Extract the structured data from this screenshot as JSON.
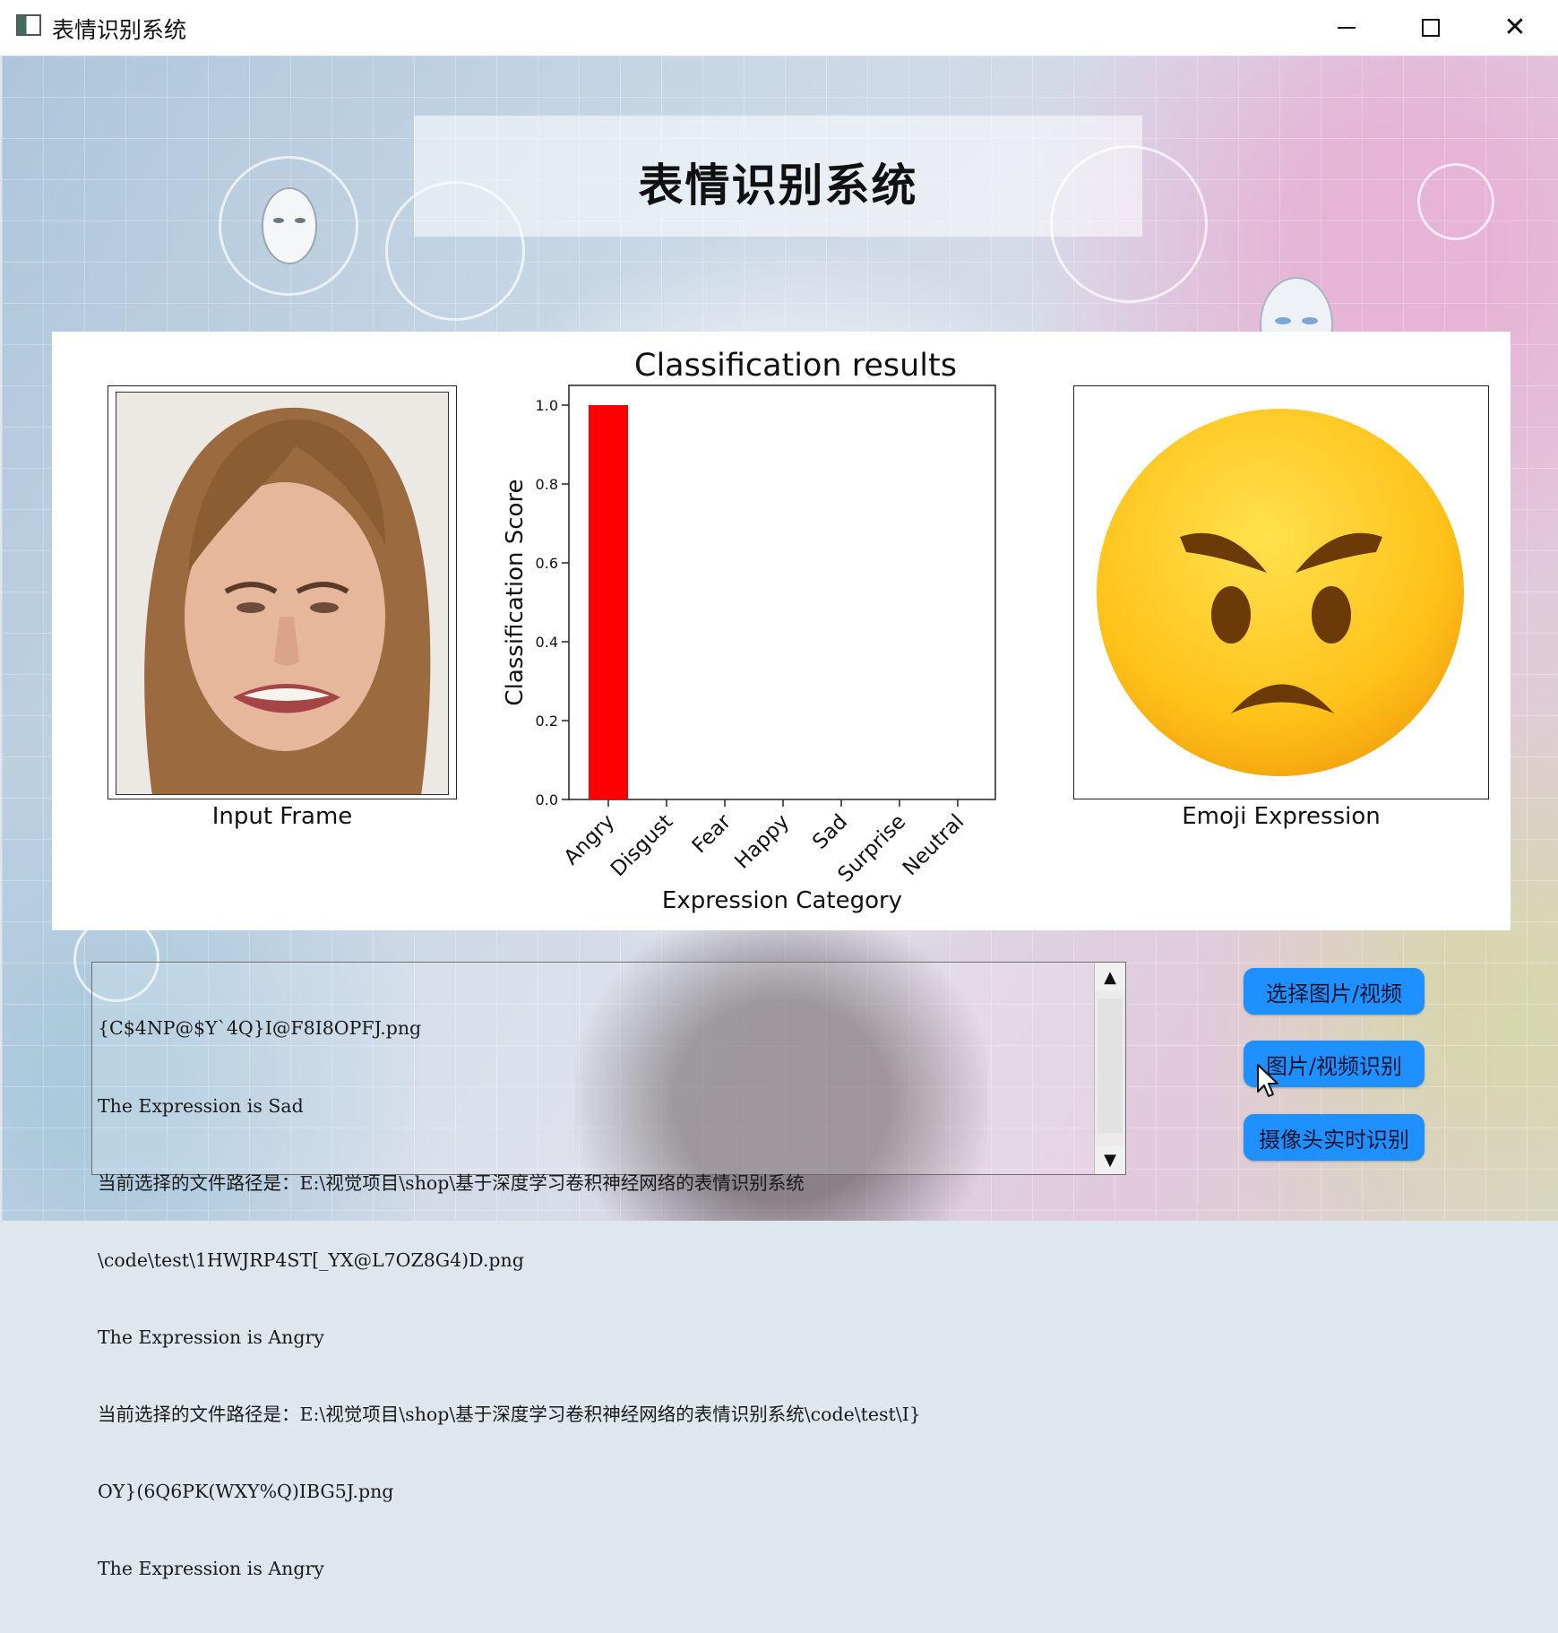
{
  "window": {
    "title": "表情识别系统",
    "controls": [
      "minimize",
      "maximize",
      "close"
    ]
  },
  "header": {
    "title": "表情识别系统"
  },
  "result_panel": {
    "input_label": "Input Frame",
    "emoji_label": "Emoji Expression",
    "emoji_icon": "angry-face-icon"
  },
  "chart_data": {
    "type": "bar",
    "title": "Classification results",
    "xlabel": "Expression Category",
    "ylabel": "Classification Score",
    "categories": [
      "Angry",
      "Disgust",
      "Fear",
      "Happy",
      "Sad",
      "Surprise",
      "Neutral"
    ],
    "values": [
      1.0,
      0.0,
      0.0,
      0.0,
      0.0,
      0.0,
      0.0
    ],
    "ylim": [
      0,
      1.05
    ],
    "yticks": [
      0.0,
      0.2,
      0.4,
      0.6,
      0.8,
      1.0
    ],
    "ytick_labels": [
      "0.0",
      "0.2",
      "0.4",
      "0.6",
      "0.8",
      "1.0"
    ],
    "bar_color": "#ff0000",
    "grid": false,
    "legend": "none"
  },
  "log": {
    "lines": [
      "{C$4NP@$Y`4Q}I@F8I8OPFJ.png",
      "The Expression is Sad",
      "当前选择的文件路径是：E:\\视觉项目\\shop\\基于深度学习卷积神经网络的表情识别系统",
      "\\code\\test\\1HWJRP4ST[_YX@L7OZ8G4)D.png",
      "The Expression is Angry",
      "当前选择的文件路径是：E:\\视觉项目\\shop\\基于深度学习卷积神经网络的表情识别系统\\code\\test\\I}",
      "OY}(6Q6PK(WXY%Q)IBG5J.png",
      "The Expression is Angry"
    ]
  },
  "buttons": {
    "select_media": "选择图片/视频",
    "recognize_media": "图片/视频识别",
    "camera_realtime": "摄像头实时识别"
  },
  "colors": {
    "button_blue": "#1e90ff",
    "bar_red": "#ff0000"
  }
}
